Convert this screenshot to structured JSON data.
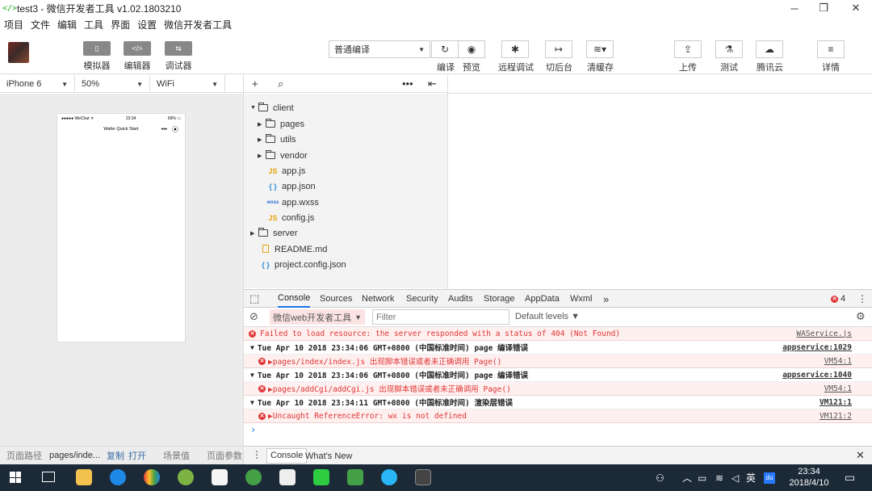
{
  "window": {
    "title": "test3 - 微信开发者工具 v1.02.1803210",
    "minimize": "─",
    "maximize": "❐",
    "close": "✕"
  },
  "menu": [
    "项目",
    "文件",
    "编辑",
    "工具",
    "界面",
    "设置",
    "微信开发者工具"
  ],
  "toolbar": {
    "modes": [
      {
        "label": "模拟器",
        "glyph": "▯"
      },
      {
        "label": "编辑器",
        "glyph": "</>"
      },
      {
        "label": "调试器",
        "glyph": "⇆"
      }
    ],
    "compile_mode": "普通编译",
    "compile_label": "编译",
    "preview_label": "预览",
    "remote_debug_label": "远程调试",
    "background_label": "切后台",
    "clear_cache_label": "清缓存",
    "upload_label": "上传",
    "test_label": "测试",
    "tencent_cloud_label": "腾讯云",
    "details_label": "详情"
  },
  "simulator": {
    "device": "iPhone 6",
    "zoom": "50%",
    "network": "WiFi",
    "status_left": "●●●●● WeChat ᯤ",
    "status_time": "23:34",
    "status_right": "69% ▭",
    "page_title": "Wafer Quick Start",
    "menu_dots": "•••",
    "record_icon": "⦿"
  },
  "sim_bottom": {
    "path_label": "页面路径",
    "path_value": "pages/inde...",
    "copy": "复制",
    "open": "打开",
    "scene_label": "场景值",
    "params_label": "页面参数"
  },
  "file_tree": {
    "items": [
      {
        "name": "client",
        "kind": "folder",
        "expanded": true
      },
      {
        "name": "pages",
        "kind": "folder"
      },
      {
        "name": "utils",
        "kind": "folder"
      },
      {
        "name": "vendor",
        "kind": "folder"
      },
      {
        "name": "app.js",
        "kind": "js",
        "badge": "JS"
      },
      {
        "name": "app.json",
        "kind": "json",
        "badge": "{ }"
      },
      {
        "name": "app.wxss",
        "kind": "wxss",
        "badge": "wxss"
      },
      {
        "name": "config.js",
        "kind": "js",
        "badge": "JS"
      },
      {
        "name": "server",
        "kind": "folder"
      },
      {
        "name": "README.md",
        "kind": "md"
      },
      {
        "name": "project.config.json",
        "kind": "json",
        "badge": "{ }"
      }
    ]
  },
  "devtools": {
    "tabs": [
      "Console",
      "Sources",
      "Network",
      "Security",
      "Audits",
      "Storage",
      "AppData",
      "Wxml"
    ],
    "more": "»",
    "error_count": "4",
    "context": "微信web开发者工具",
    "filter_placeholder": "Filter",
    "levels": "Default levels ▼",
    "prompt": "›",
    "logs": [
      {
        "type": "error",
        "text": "Failed to load resource: the server responded with a status of 404 (Not Found)",
        "source": "WAService.js"
      },
      {
        "type": "group",
        "text": "Tue Apr 10 2018 23:34:06 GMT+0800 (中国标准时间) page 编译错误",
        "source": "appservice:1029"
      },
      {
        "type": "error-sub",
        "text": "▶pages/index/index.js 出现脚本错误或者未正确调用 Page()",
        "source": "VM54:1"
      },
      {
        "type": "group",
        "text": "Tue Apr 10 2018 23:34:06 GMT+0800 (中国标准时间) page 编译错误",
        "source": "appservice:1040"
      },
      {
        "type": "error-sub",
        "text": "▶pages/addCgi/addCgi.js 出现脚本错误或者未正确调用 Page()",
        "source": "VM54:1"
      },
      {
        "type": "group",
        "text": "Tue Apr 10 2018 23:34:11 GMT+0800 (中国标准时间) 渲染层错误",
        "source": "VM121:1"
      },
      {
        "type": "error-sub",
        "text": "▶Uncaught ReferenceError: wx is not defined",
        "source": "VM121:2"
      }
    ],
    "drawer_tabs": [
      "Console",
      "What's New"
    ]
  },
  "taskbar": {
    "ime": "英",
    "time": "23:34",
    "date": "2018/4/10",
    "du": "du"
  }
}
